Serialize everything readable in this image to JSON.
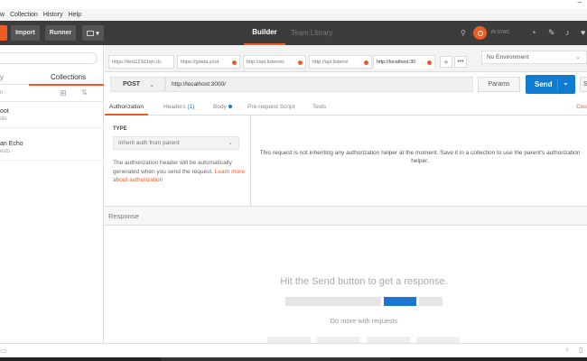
{
  "titlebar": {
    "minimize_glyph": "–"
  },
  "menu": [
    "w",
    "Collection",
    "History",
    "Help"
  ],
  "header": {
    "import_label": "Import",
    "runner_label": "Runner",
    "builder_label": "Builder",
    "team_library_label": "Team Library",
    "sync_label": "IN SYNC",
    "accent_color": "#ef5b25"
  },
  "sidebar": {
    "history_label": "y",
    "collections_label": "Collections",
    "tools_label": "n",
    "collections": [
      {
        "name": "oot",
        "count": "sts"
      },
      {
        "name": "an Echo",
        "count": "ests"
      }
    ]
  },
  "request_tabs": [
    {
      "label": "https://test123d1qn.clc",
      "dot": false
    },
    {
      "label": "https://gdata.yout",
      "dot": true
    },
    {
      "label": "http://api.listenvic",
      "dot": true
    },
    {
      "label": "http://api.listenvi",
      "dot": true
    },
    {
      "label": "http://localhost:30",
      "dot": true,
      "active": true
    }
  ],
  "tab_controls": {
    "plus": "+",
    "more": "•••"
  },
  "environment": {
    "selected": "No Environment"
  },
  "request": {
    "method": "POST",
    "url": "http://localhost:3000/",
    "params_label": "Params",
    "send_label": "Send",
    "save_label": "S"
  },
  "subtabs": {
    "authorization": "Authorization",
    "headers": "Headers",
    "headers_count": "(1)",
    "body": "Body",
    "prerequest": "Pre-request Script",
    "tests": "Tests",
    "cookies": "Coo"
  },
  "auth": {
    "type_label": "TYPE",
    "type_value": "Inherit auth from parent",
    "description": "The authorization header will be automatically generated when you send the request. ",
    "learn_more": "Learn more about authorization",
    "message": "This request is not inheriting any authorization helper at the moment. Save it in a collection to use the parent's authorization helper."
  },
  "response": {
    "label": "Response",
    "hit_send": "Hit the Send button to get a response.",
    "do_more": "Do more with requests"
  }
}
